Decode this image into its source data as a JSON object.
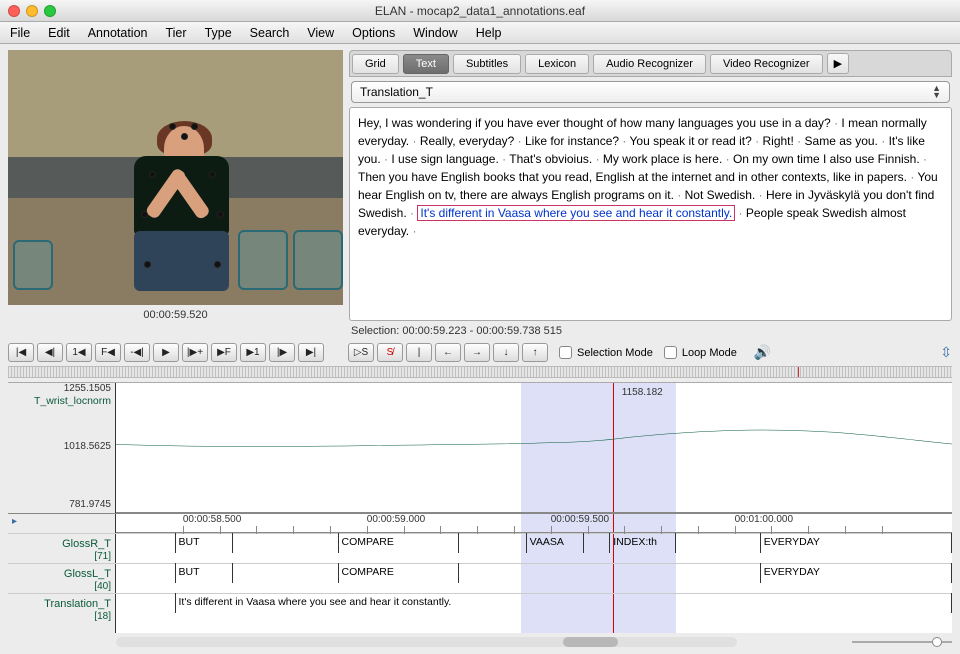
{
  "window": {
    "title": "ELAN - mocap2_data1_annotations.eaf"
  },
  "menu": [
    "File",
    "Edit",
    "Annotation",
    "Tier",
    "Type",
    "Search",
    "View",
    "Options",
    "Window",
    "Help"
  ],
  "video": {
    "timecode": "00:00:59.520"
  },
  "tabs": {
    "items": [
      "Grid",
      "Text",
      "Subtitles",
      "Lexicon",
      "Audio Recognizer",
      "Video Recognizer"
    ],
    "active": "Text",
    "arrow": "▶"
  },
  "tier_dropdown": "Translation_T",
  "transcript": {
    "segments": [
      "Hey, I was wondering if you have ever thought of how many languages you use in a day?",
      "I mean normally everyday.",
      "Really, everyday?",
      "Like for instance?",
      "You speak it or read it?",
      "Right!",
      "Same as you.",
      "It's like you.",
      "I use sign language.",
      "That's obvioius.",
      "My work place is here.",
      "On my own time I also use Finnish.",
      "Then you have English books that you read, English at the internet and in other contexts, like in papers.",
      "You hear English on tv, there are always English programs on it.",
      "Not Swedish.",
      "Here in Jyväskylä you don't find Swedish."
    ],
    "selected": "It's different in Vaasa where you see and hear it constantly.",
    "after": [
      "People speak Swedish almost everyday."
    ]
  },
  "selection_label": "Selection: 00:00:59.223 - 00:00:59.738  515",
  "controls": {
    "left": [
      "|◀",
      "◀|",
      "1◀",
      "F◀",
      "-◀|",
      "▶",
      "|▶+",
      "▶F",
      "▶1",
      "|▶",
      "▶|"
    ],
    "right": [
      "▷S",
      "S̸",
      "|",
      "←",
      "→",
      "↓",
      "↑"
    ],
    "selection_mode": "Selection Mode",
    "loop_mode": "Loop Mode"
  },
  "chart_data": {
    "type": "line",
    "title": "",
    "tier_label": "T_wrist_locnorm",
    "y_ticks": [
      781.9745,
      1018.5625,
      1255.1505
    ],
    "yaxis_top": "1255.1505",
    "yaxis_mid": "1018.5625",
    "yaxis_bot": "781.9745",
    "cursor_value": "1158.182",
    "x_ticks": [
      "00:00:58.500",
      "00:00:59.000",
      "00:00:59.500",
      "00:01:00.000"
    ],
    "selection": {
      "start_pct": 48.5,
      "end_pct": 67.0
    },
    "playhead_pct": 59.5,
    "series": [
      {
        "name": "T_wrist_locnorm",
        "values_relpath": "M0,55 C40,58 90,60 140,60 C200,60 260,58 320,56 C360,55 400,54 440,51 C470,49 490,46 510,40 C540,32 580,25 620,22 C660,20 700,22 740,30 C780,38 820,50 840,54"
      }
    ]
  },
  "tiers": [
    {
      "name": "GlossR_T",
      "count": "[71]",
      "annotations": [
        {
          "label": "BUT",
          "start_pct": 7,
          "end_pct": 14
        },
        {
          "label": "COMPARE",
          "start_pct": 26.5,
          "end_pct": 41
        },
        {
          "label": "VAASA",
          "start_pct": 49,
          "end_pct": 56
        },
        {
          "label": "INDEX:th",
          "start_pct": 59,
          "end_pct": 67
        },
        {
          "label": "EVERYDAY",
          "start_pct": 77,
          "end_pct": 100
        }
      ]
    },
    {
      "name": "GlossL_T",
      "count": "[40]",
      "annotations": [
        {
          "label": "BUT",
          "start_pct": 7,
          "end_pct": 14
        },
        {
          "label": "COMPARE",
          "start_pct": 26.5,
          "end_pct": 41
        },
        {
          "label": "EVERYDAY",
          "start_pct": 77,
          "end_pct": 100
        }
      ]
    },
    {
      "name": "Translation_T",
      "count": "[18]",
      "annotations": [
        {
          "label": "It's different in Vaasa where you see and hear it constantly.",
          "start_pct": 7,
          "end_pct": 100
        }
      ]
    }
  ]
}
